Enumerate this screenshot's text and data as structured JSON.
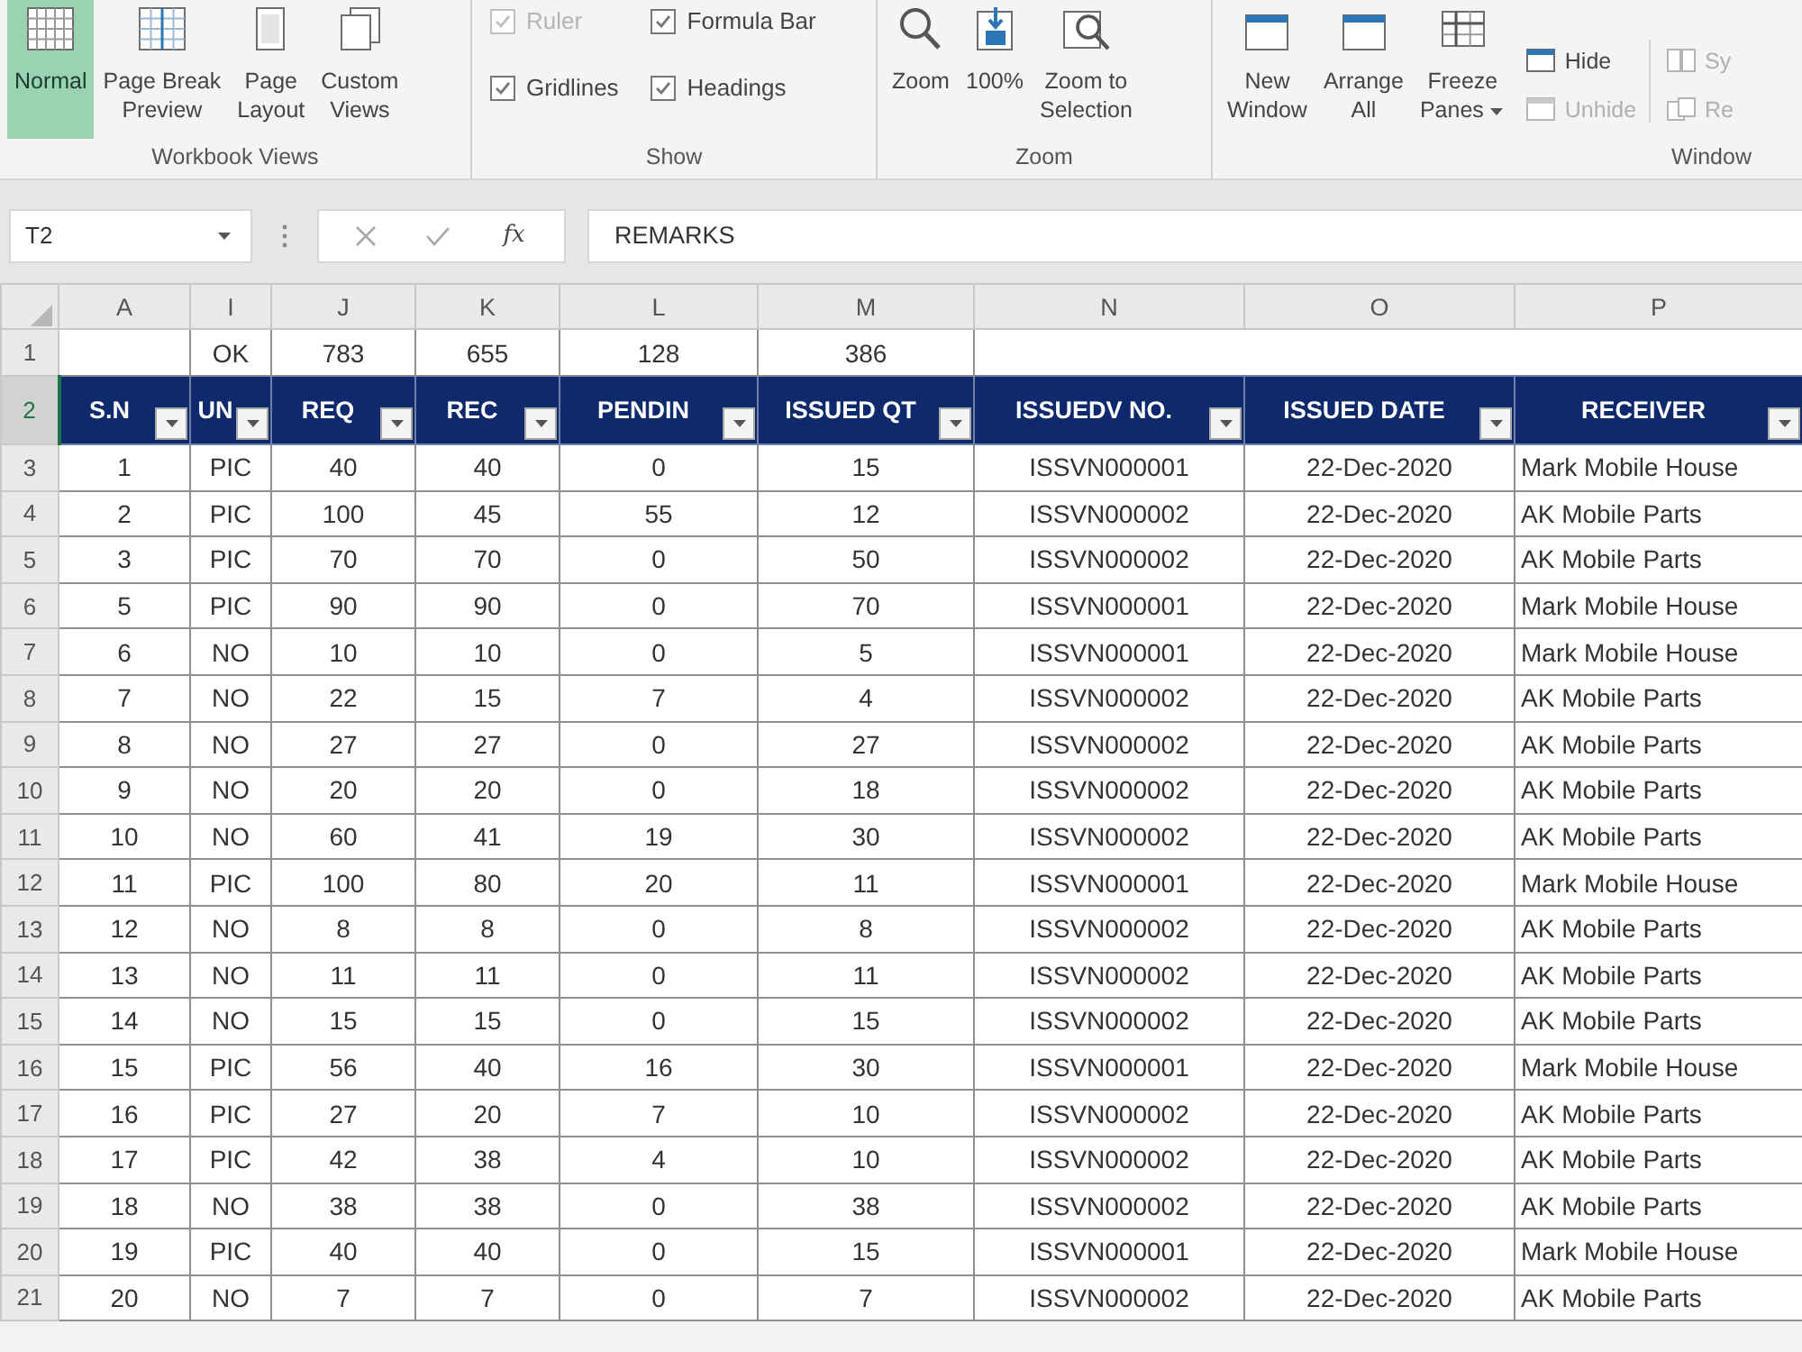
{
  "ribbon": {
    "groups": [
      {
        "label": "Workbook Views",
        "items": [
          {
            "kind": "large",
            "label": "Normal",
            "selected": true
          },
          {
            "kind": "large",
            "label": "Page Break\nPreview",
            "selected": false
          },
          {
            "kind": "large",
            "label": "Page\nLayout",
            "selected": false
          },
          {
            "kind": "large",
            "label": "Custom\nViews",
            "selected": false
          }
        ]
      },
      {
        "label": "Show",
        "items": [
          {
            "kind": "checkbox",
            "label": "Ruler",
            "checked": true,
            "disabled": true
          },
          {
            "kind": "checkbox",
            "label": "Formula Bar",
            "checked": true,
            "disabled": false
          },
          {
            "kind": "checkbox",
            "label": "Gridlines",
            "checked": true,
            "disabled": false
          },
          {
            "kind": "checkbox",
            "label": "Headings",
            "checked": true,
            "disabled": false
          }
        ]
      },
      {
        "label": "Zoom",
        "items": [
          {
            "kind": "large",
            "label": "Zoom"
          },
          {
            "kind": "large",
            "label": "100%"
          },
          {
            "kind": "large",
            "label": "Zoom to\nSelection"
          }
        ]
      },
      {
        "label": "Window",
        "items": [
          {
            "kind": "large",
            "label": "New\nWindow"
          },
          {
            "kind": "large",
            "label": "Arrange\nAll"
          },
          {
            "kind": "large",
            "label": "Freeze\nPanes",
            "dropdown": true
          },
          {
            "kind": "small",
            "label": "Hide",
            "disabled": false
          },
          {
            "kind": "small",
            "label": "Unhide",
            "disabled": true
          },
          {
            "kind": "small",
            "label": "Sy",
            "disabled": true
          },
          {
            "kind": "small",
            "label": "Re",
            "disabled": true
          }
        ]
      }
    ]
  },
  "formula_bar": {
    "name_box": "T2",
    "insert_function": "fx",
    "formula": "REMARKS"
  },
  "sheet": {
    "columns": [
      "A",
      "I",
      "J",
      "K",
      "L",
      "M",
      "N",
      "O",
      "P"
    ],
    "rows": [
      {
        "number": "1",
        "selected": false,
        "kind": "totals",
        "cells": [
          null,
          "OK",
          "783",
          "655",
          "128",
          "386"
        ]
      },
      {
        "number": "2",
        "selected": true,
        "kind": "header",
        "cells": [
          "S.N",
          "UN",
          "REQ",
          "REC",
          "PENDIN",
          "ISSUED QT",
          "ISSUEDV NO.",
          "ISSUED DATE",
          "RECEIVER"
        ]
      },
      {
        "number": "3",
        "selected": false,
        "kind": "data",
        "cells": [
          "1",
          "PIC",
          "40",
          "40",
          "0",
          "15",
          "ISSVN000001",
          "22-Dec-2020",
          "Mark Mobile House"
        ]
      },
      {
        "number": "4",
        "selected": false,
        "kind": "data",
        "cells": [
          "2",
          "PIC",
          "100",
          "45",
          "55",
          "12",
          "ISSVN000002",
          "22-Dec-2020",
          "AK Mobile Parts"
        ]
      },
      {
        "number": "5",
        "selected": false,
        "kind": "data",
        "cells": [
          "3",
          "PIC",
          "70",
          "70",
          "0",
          "50",
          "ISSVN000002",
          "22-Dec-2020",
          "AK Mobile Parts"
        ]
      },
      {
        "number": "6",
        "selected": false,
        "kind": "data",
        "cells": [
          "5",
          "PIC",
          "90",
          "90",
          "0",
          "70",
          "ISSVN000001",
          "22-Dec-2020",
          "Mark Mobile House"
        ]
      },
      {
        "number": "7",
        "selected": false,
        "kind": "data",
        "cells": [
          "6",
          "NO",
          "10",
          "10",
          "0",
          "5",
          "ISSVN000001",
          "22-Dec-2020",
          "Mark Mobile House"
        ]
      },
      {
        "number": "8",
        "selected": false,
        "kind": "data",
        "cells": [
          "7",
          "NO",
          "22",
          "15",
          "7",
          "4",
          "ISSVN000002",
          "22-Dec-2020",
          "AK Mobile Parts"
        ]
      },
      {
        "number": "9",
        "selected": false,
        "kind": "data",
        "cells": [
          "8",
          "NO",
          "27",
          "27",
          "0",
          "27",
          "ISSVN000002",
          "22-Dec-2020",
          "AK Mobile Parts"
        ]
      },
      {
        "number": "10",
        "selected": false,
        "kind": "data",
        "cells": [
          "9",
          "NO",
          "20",
          "20",
          "0",
          "18",
          "ISSVN000002",
          "22-Dec-2020",
          "AK Mobile Parts"
        ]
      },
      {
        "number": "11",
        "selected": false,
        "kind": "data",
        "cells": [
          "10",
          "NO",
          "60",
          "41",
          "19",
          "30",
          "ISSVN000002",
          "22-Dec-2020",
          "AK Mobile Parts"
        ]
      },
      {
        "number": "12",
        "selected": false,
        "kind": "data",
        "cells": [
          "11",
          "PIC",
          "100",
          "80",
          "20",
          "11",
          "ISSVN000001",
          "22-Dec-2020",
          "Mark Mobile House"
        ]
      },
      {
        "number": "13",
        "selected": false,
        "kind": "data",
        "cells": [
          "12",
          "NO",
          "8",
          "8",
          "0",
          "8",
          "ISSVN000002",
          "22-Dec-2020",
          "AK Mobile Parts"
        ]
      },
      {
        "number": "14",
        "selected": false,
        "kind": "data",
        "cells": [
          "13",
          "NO",
          "11",
          "11",
          "0",
          "11",
          "ISSVN000002",
          "22-Dec-2020",
          "AK Mobile Parts"
        ]
      },
      {
        "number": "15",
        "selected": false,
        "kind": "data",
        "cells": [
          "14",
          "NO",
          "15",
          "15",
          "0",
          "15",
          "ISSVN000002",
          "22-Dec-2020",
          "AK Mobile Parts"
        ]
      },
      {
        "number": "16",
        "selected": false,
        "kind": "data",
        "cells": [
          "15",
          "PIC",
          "56",
          "40",
          "16",
          "30",
          "ISSVN000001",
          "22-Dec-2020",
          "Mark Mobile House"
        ]
      },
      {
        "number": "17",
        "selected": false,
        "kind": "data",
        "cells": [
          "16",
          "PIC",
          "27",
          "20",
          "7",
          "10",
          "ISSVN000002",
          "22-Dec-2020",
          "AK Mobile Parts"
        ]
      },
      {
        "number": "18",
        "selected": false,
        "kind": "data",
        "cells": [
          "17",
          "PIC",
          "42",
          "38",
          "4",
          "10",
          "ISSVN000002",
          "22-Dec-2020",
          "AK Mobile Parts"
        ]
      },
      {
        "number": "19",
        "selected": false,
        "kind": "data",
        "cells": [
          "18",
          "NO",
          "38",
          "38",
          "0",
          "38",
          "ISSVN000002",
          "22-Dec-2020",
          "AK Mobile Parts"
        ]
      },
      {
        "number": "20",
        "selected": false,
        "kind": "data",
        "cells": [
          "19",
          "PIC",
          "40",
          "40",
          "0",
          "15",
          "ISSVN000001",
          "22-Dec-2020",
          "Mark Mobile House"
        ]
      },
      {
        "number": "21",
        "selected": false,
        "kind": "data",
        "cells": [
          "20",
          "NO",
          "7",
          "7",
          "0",
          "7",
          "ISSVN000002",
          "22-Dec-2020",
          "AK Mobile Parts"
        ]
      }
    ]
  }
}
